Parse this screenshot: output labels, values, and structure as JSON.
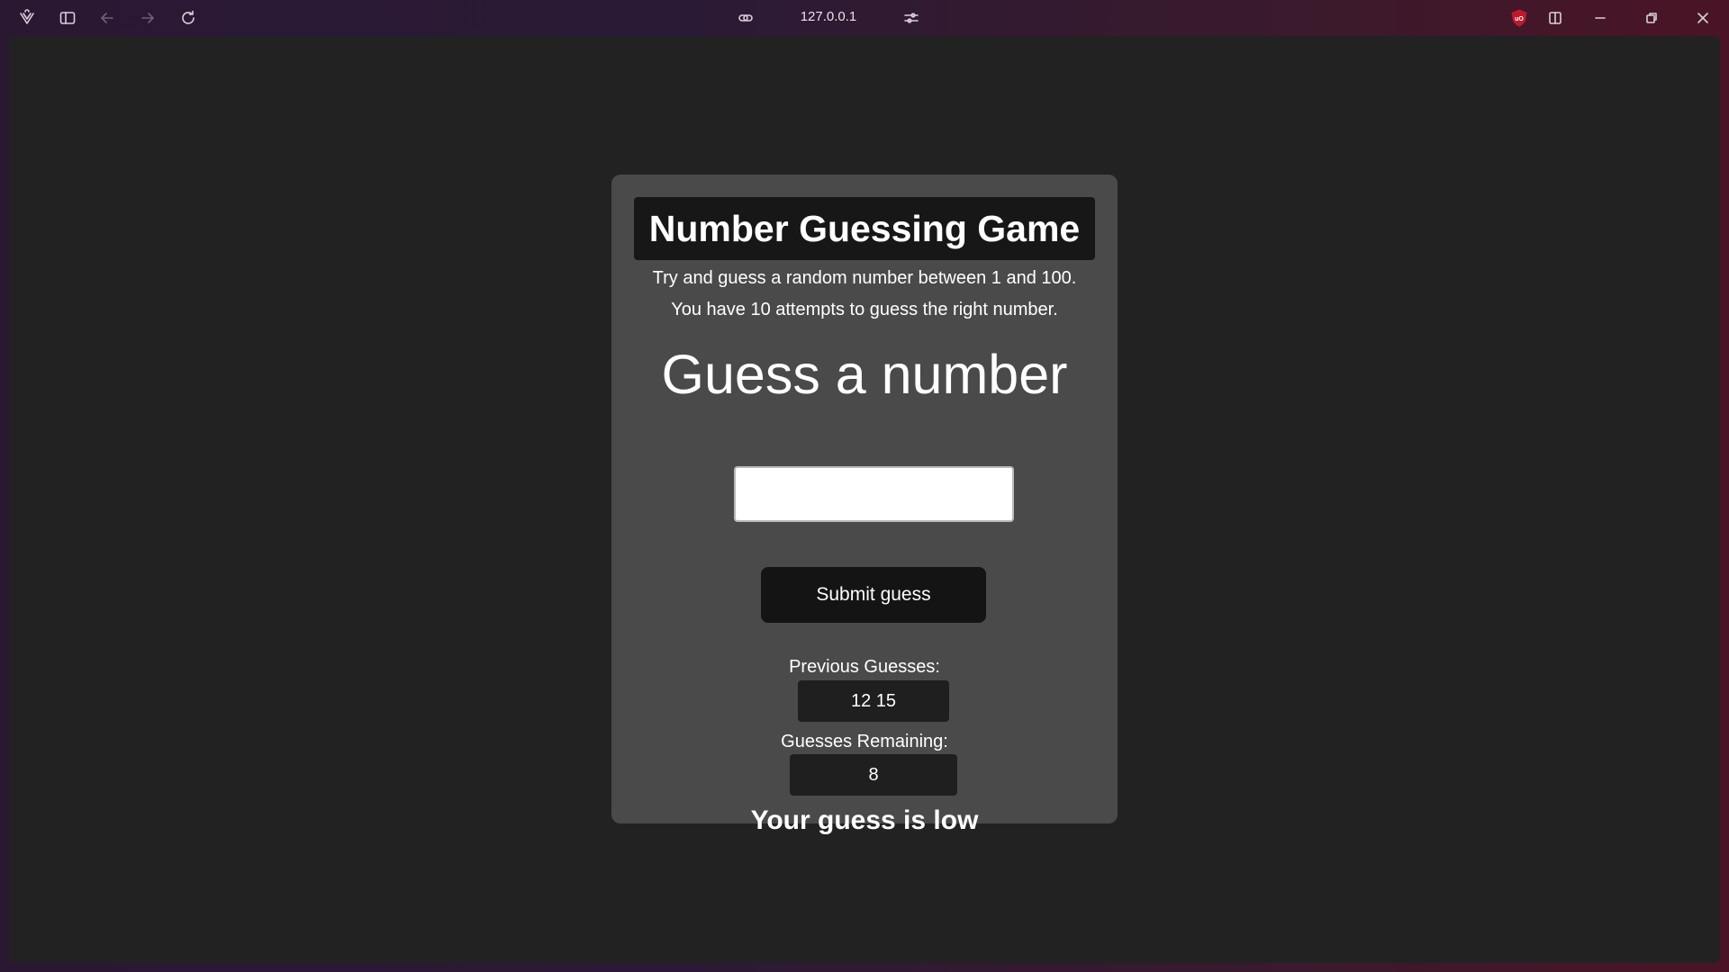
{
  "browser": {
    "url": "127.0.0.1",
    "icons": {
      "logo": "vivaldi-logo-icon",
      "sidebar": "sidebar-toggle-icon",
      "back": "arrow-left-icon",
      "forward": "arrow-right-icon",
      "reload": "reload-icon",
      "link": "link-icon",
      "settings": "sliders-icon",
      "ublock": "ublock-origin-icon",
      "split": "split-view-icon",
      "minimize": "minimize-icon",
      "restore": "restore-icon",
      "close": "close-icon"
    },
    "colors": {
      "titlebar": "#2b1a35",
      "ublock": "#c0192c"
    }
  },
  "game": {
    "title": "Number Guessing Game",
    "description_line1": "Try and guess a random number between 1 and 100.",
    "description_line2": "You have 10 attempts to guess the right number.",
    "heading": "Guess a number",
    "input_value": "",
    "submit_label": "Submit guess",
    "previous_guesses_label": "Previous Guesses:",
    "previous_guesses_value": "12 15",
    "guesses_remaining_label": "Guesses Remaining:",
    "guesses_remaining_value": "8",
    "result_message": "Your guess is low"
  },
  "colors": {
    "page_background": "#222222",
    "card_background": "#4a4a4a",
    "title_background": "#171717",
    "button_background": "#141414",
    "value_box_background": "#1f1f1f",
    "text": "#ffffff"
  }
}
